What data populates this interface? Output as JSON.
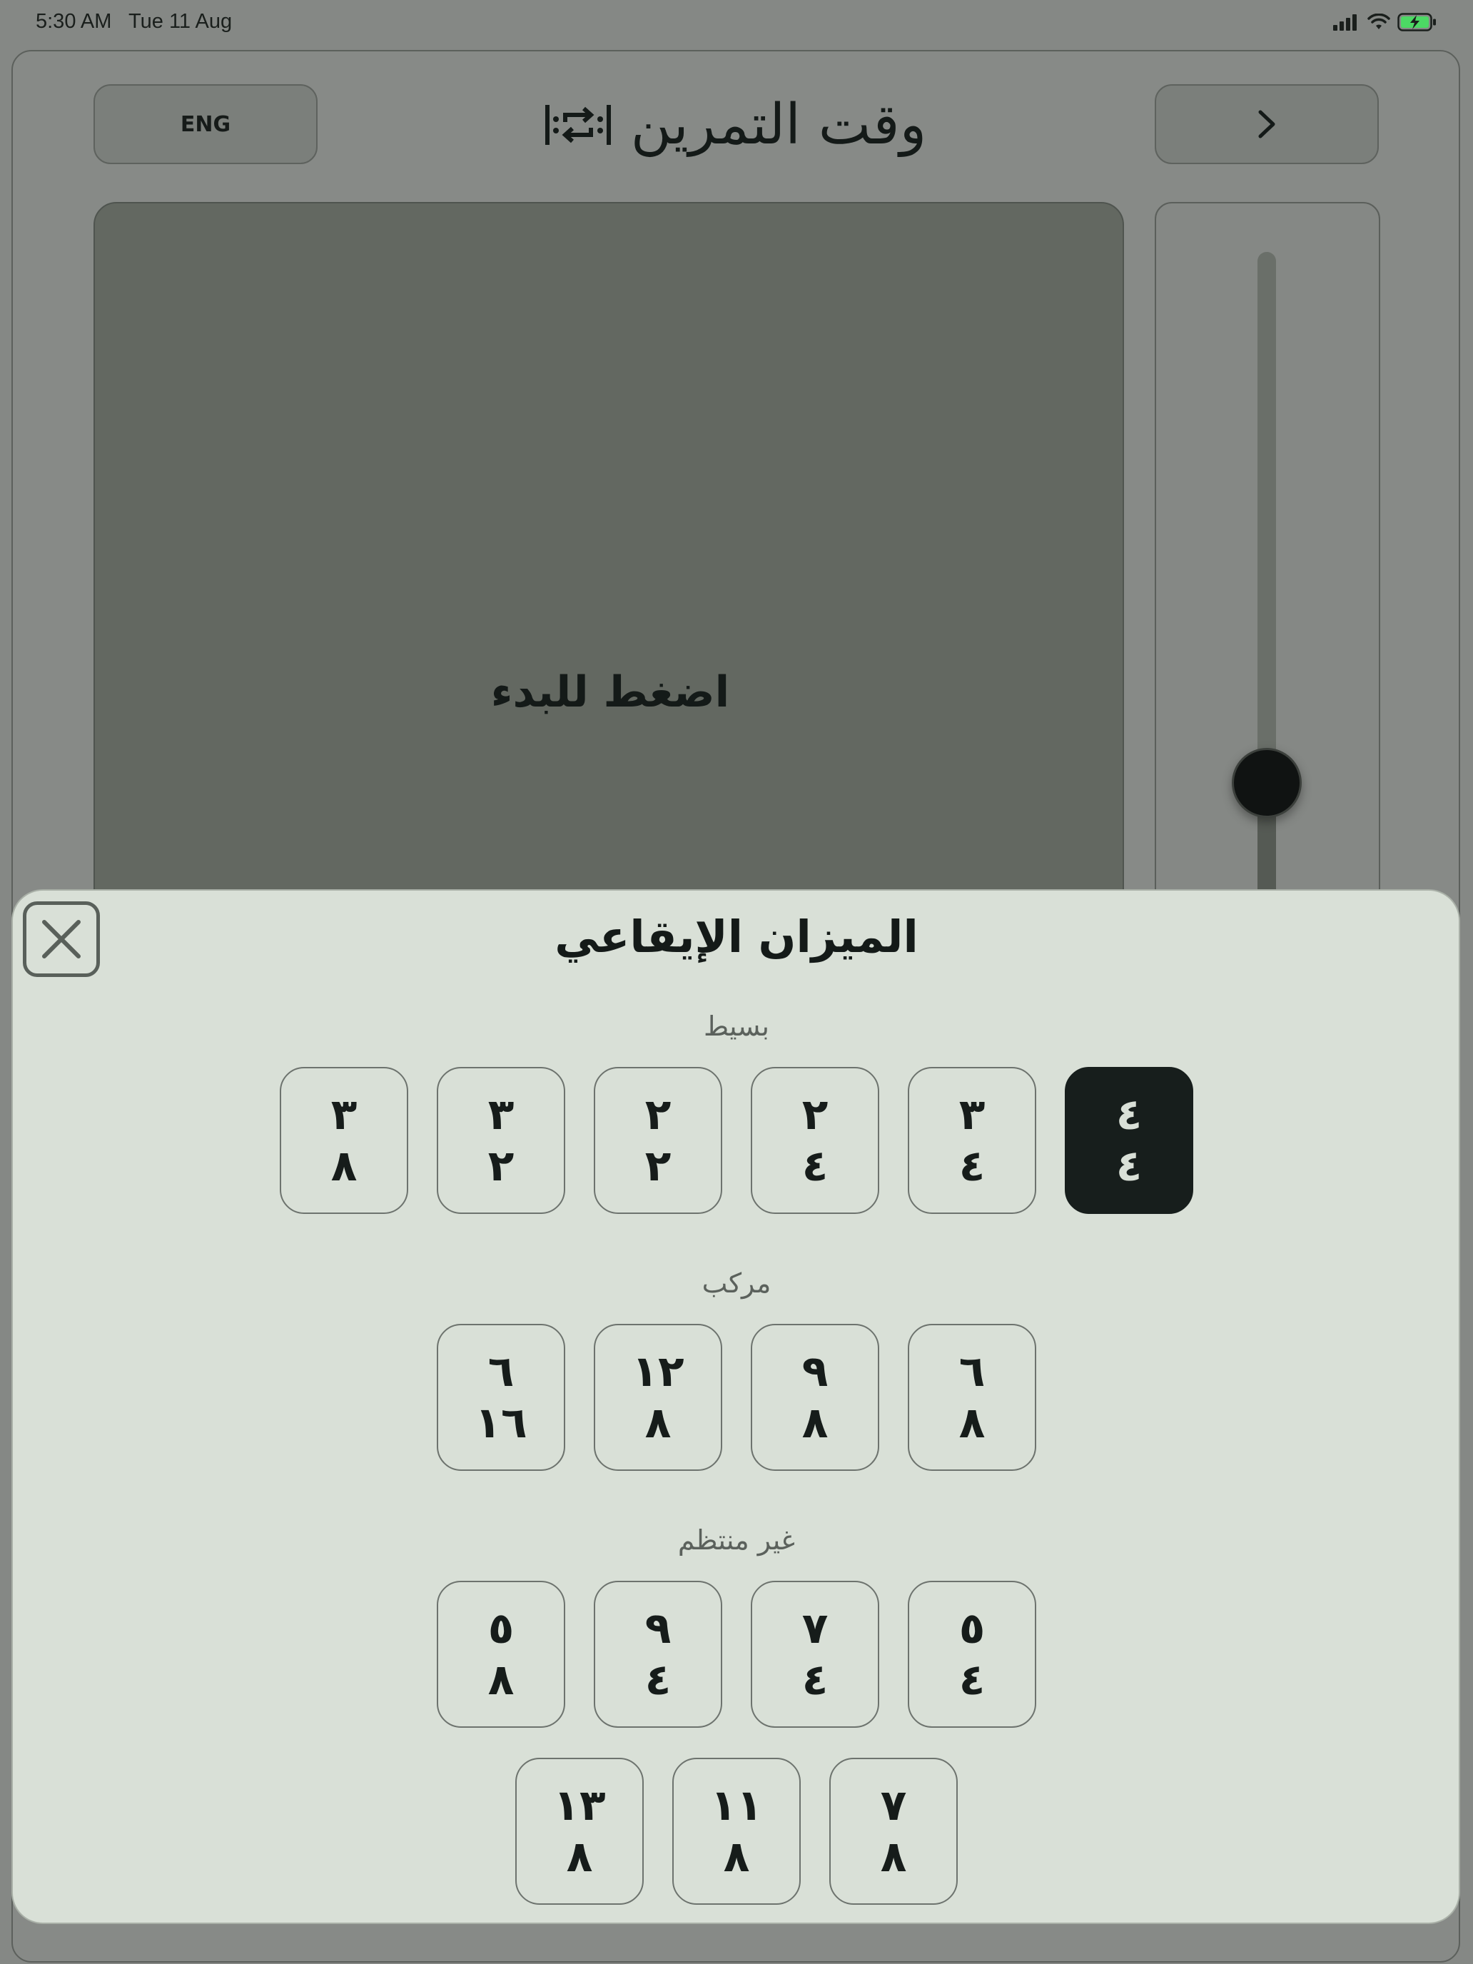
{
  "status_bar": {
    "time": "5:30 AM",
    "date": "Tue 11 Aug",
    "icons": [
      "cellular-signal-icon",
      "wifi-icon",
      "battery-charging-icon"
    ],
    "battery_color": "#4cd964"
  },
  "app": {
    "language_button": "ENG",
    "title": "وقت التمرين",
    "title_icon": "loop-repeat-icon",
    "next_icon": "chevron-right-icon",
    "stage_prompt": "اضغط للبدء"
  },
  "sheet": {
    "title": "الميزان الإيقاعي",
    "close_icon": "close-icon",
    "sections": [
      {
        "label": "بسيط",
        "signatures": [
          {
            "top": "٤",
            "bottom": "٤",
            "selected": true
          },
          {
            "top": "٣",
            "bottom": "٤",
            "selected": false
          },
          {
            "top": "٢",
            "bottom": "٤",
            "selected": false
          },
          {
            "top": "٢",
            "bottom": "٢",
            "selected": false
          },
          {
            "top": "٣",
            "bottom": "٢",
            "selected": false
          },
          {
            "top": "٣",
            "bottom": "٨",
            "selected": false
          }
        ]
      },
      {
        "label": "مركب",
        "signatures": [
          {
            "top": "٦",
            "bottom": "٨",
            "selected": false
          },
          {
            "top": "٩",
            "bottom": "٨",
            "selected": false
          },
          {
            "top": "١٢",
            "bottom": "٨",
            "selected": false
          },
          {
            "top": "٦",
            "bottom": "١٦",
            "selected": false
          }
        ]
      },
      {
        "label": "غير منتظم",
        "signatures": [
          {
            "top": "٥",
            "bottom": "٤",
            "selected": false
          },
          {
            "top": "٧",
            "bottom": "٤",
            "selected": false
          },
          {
            "top": "٩",
            "bottom": "٤",
            "selected": false
          },
          {
            "top": "٥",
            "bottom": "٨",
            "selected": false
          },
          {
            "top": "٧",
            "bottom": "٨",
            "selected": false
          },
          {
            "top": "١١",
            "bottom": "٨",
            "selected": false
          },
          {
            "top": "١٣",
            "bottom": "٨",
            "selected": false
          }
        ]
      }
    ]
  }
}
